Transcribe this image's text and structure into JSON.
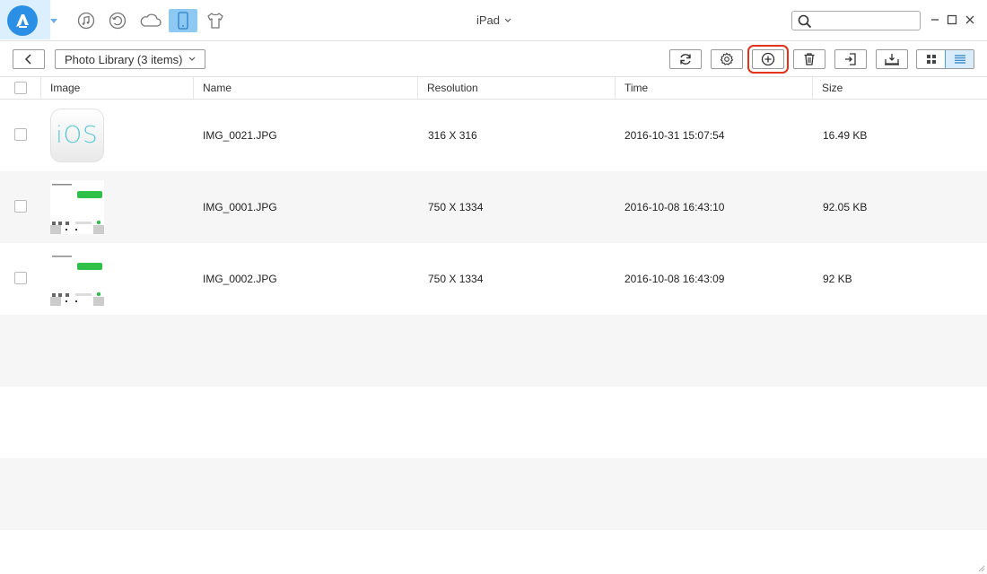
{
  "app": {
    "device_title": "iPad",
    "nav_icons": [
      "music-icon",
      "history-icon",
      "cloud-icon",
      "phone-icon",
      "shirt-icon"
    ],
    "search_placeholder": "",
    "brand_color": "#2c8fe6",
    "highlight_color": "#e5331b"
  },
  "toolbar": {
    "breadcrumb": "Photo Library (3 items)",
    "buttons": [
      "refresh-icon",
      "settings-icon",
      "add-icon",
      "delete-icon",
      "export-to-device-icon",
      "export-to-computer-icon"
    ],
    "view_modes": [
      "grid-view-icon",
      "list-view-icon"
    ],
    "active_view": "list"
  },
  "table": {
    "columns": [
      "Image",
      "Name",
      "Resolution",
      "Time",
      "Size"
    ],
    "rows": [
      {
        "name": "IMG_0021.JPG",
        "resolution": "316 X 316",
        "time": "2016-10-31 15:07:54",
        "size": "16.49 KB",
        "thumb_text": "iOS"
      },
      {
        "name": "IMG_0001.JPG",
        "resolution": "750 X 1334",
        "time": "2016-10-08 16:43:10",
        "size": "92.05 KB"
      },
      {
        "name": "IMG_0002.JPG",
        "resolution": "750 X 1334",
        "time": "2016-10-08 16:43:09",
        "size": "92 KB"
      }
    ]
  }
}
